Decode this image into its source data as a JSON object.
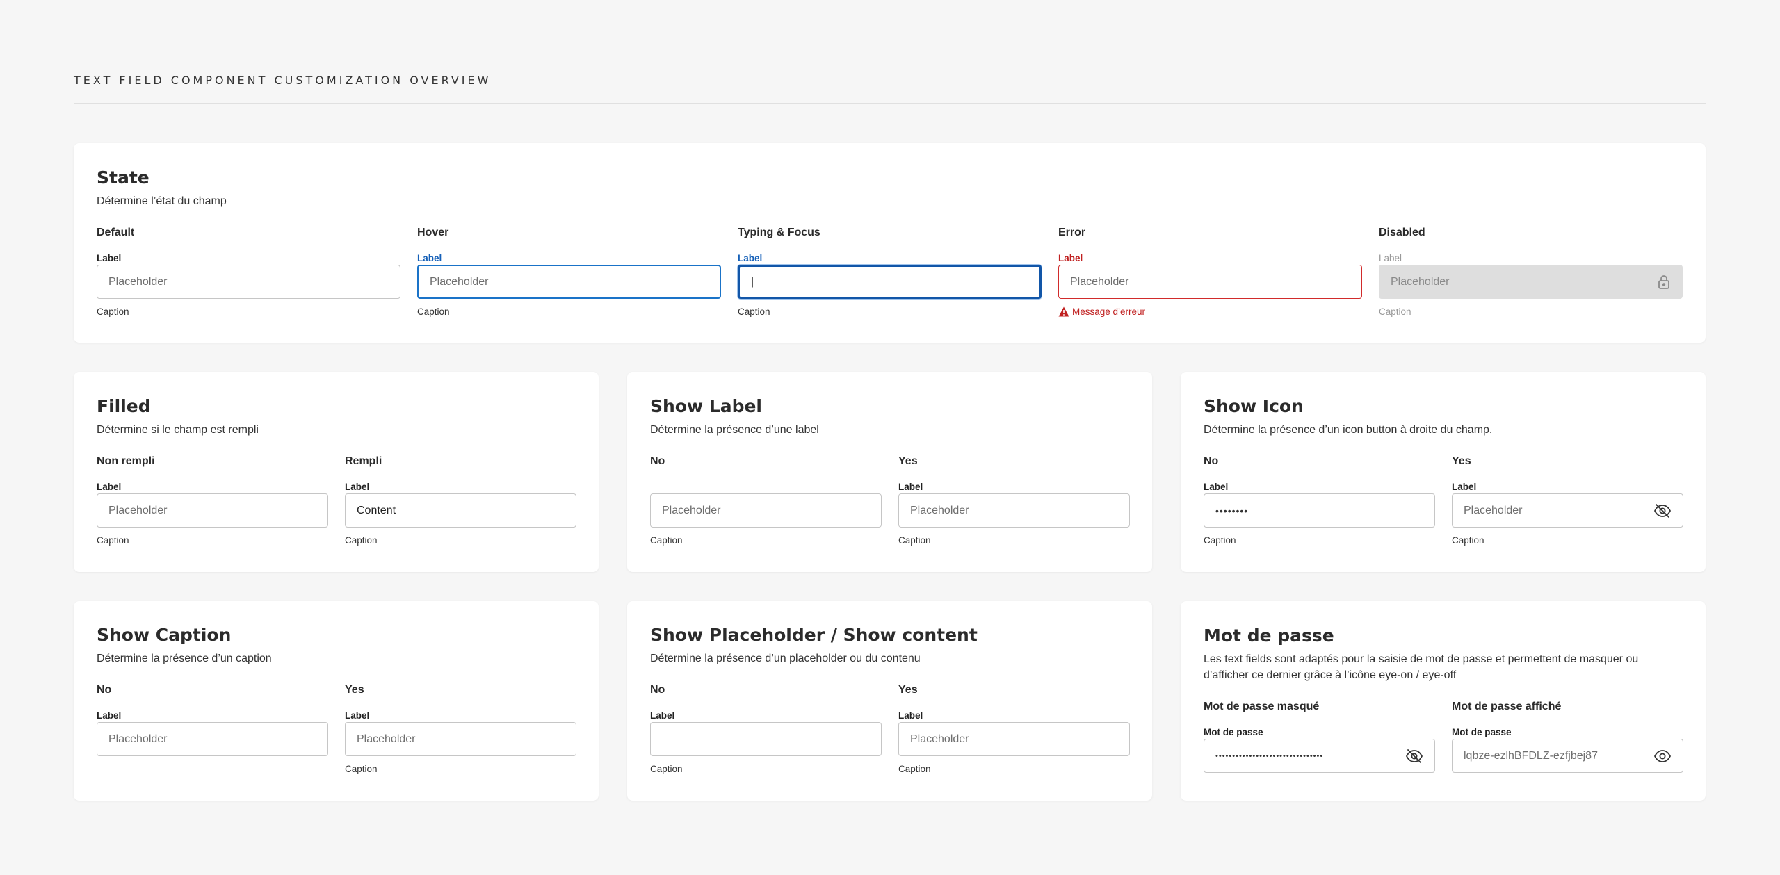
{
  "page": {
    "title": "TEXT FIELD COMPONENT CUSTOMIZATION OVERVIEW"
  },
  "state": {
    "title": "State",
    "desc": "Détermine l’état du champ",
    "default": {
      "variant": "Default",
      "label": "Label",
      "placeholder": "Placeholder",
      "caption": "Caption"
    },
    "hover": {
      "variant": "Hover",
      "label": "Label",
      "placeholder": "Placeholder",
      "caption": "Caption"
    },
    "focus": {
      "variant": "Typing & Focus",
      "label": "Label",
      "value": "|",
      "caption": "Caption"
    },
    "error": {
      "variant": "Error",
      "label": "Label",
      "placeholder": "Placeholder",
      "caption": "Message d’erreur"
    },
    "disabled": {
      "variant": "Disabled",
      "label": "Label",
      "placeholder": "Placeholder",
      "caption": "Caption"
    }
  },
  "filled": {
    "title": "Filled",
    "desc": "Détermine si le champ est rempli",
    "no": {
      "variant": "Non rempli",
      "label": "Label",
      "placeholder": "Placeholder",
      "caption": "Caption"
    },
    "yes": {
      "variant": "Rempli",
      "label": "Label",
      "value": "Content",
      "caption": "Caption"
    }
  },
  "show_label": {
    "title": "Show Label",
    "desc": "Détermine la présence d’une label",
    "no": {
      "variant": "No",
      "placeholder": "Placeholder",
      "caption": "Caption"
    },
    "yes": {
      "variant": "Yes",
      "label": "Label",
      "placeholder": "Placeholder",
      "caption": "Caption"
    }
  },
  "show_icon": {
    "title": "Show Icon",
    "desc": "Détermine la présence d’un icon button à droite du champ.",
    "no": {
      "variant": "No",
      "label": "Label",
      "value": "••••••••",
      "caption": "Caption"
    },
    "yes": {
      "variant": "Yes",
      "label": "Label",
      "placeholder": "Placeholder",
      "caption": "Caption",
      "icon": "eye-off-icon"
    }
  },
  "show_caption": {
    "title": "Show Caption",
    "desc": "Détermine la présence d’un caption",
    "no": {
      "variant": "No",
      "label": "Label",
      "placeholder": "Placeholder"
    },
    "yes": {
      "variant": "Yes",
      "label": "Label",
      "placeholder": "Placeholder",
      "caption": "Caption"
    }
  },
  "show_placeholder": {
    "title": "Show Placeholder / Show content",
    "desc": "Détermine la présence d’un placeholder ou du contenu",
    "no": {
      "variant": "No",
      "label": "Label",
      "caption": "Caption"
    },
    "yes": {
      "variant": "Yes",
      "label": "Label",
      "placeholder": "Placeholder",
      "caption": "Caption"
    }
  },
  "password": {
    "title": "Mot de passe",
    "desc_line1": "Les text fields sont adaptés pour la saisie de mot de passe et permettent de masquer ou",
    "desc_line2": "d’afficher ce dernier grâce à l’icône eye-on / eye-off",
    "masked": {
      "variant": "Mot de passe masqué",
      "label": "Mot de passe",
      "value": "••••••••••••••••••••••••••••••••",
      "icon": "eye-off-icon"
    },
    "shown": {
      "variant": "Mot de passe affiché",
      "label": "Mot de passe",
      "value": "lqbze-ezlhBFDLZ-ezfjbej87",
      "icon": "eye-icon"
    }
  },
  "colors": {
    "hover": "#1a73c8",
    "focus": "#1256a8",
    "error": "#d12b2b",
    "disabled_bg": "#dedede",
    "background": "#f6f6f6"
  }
}
